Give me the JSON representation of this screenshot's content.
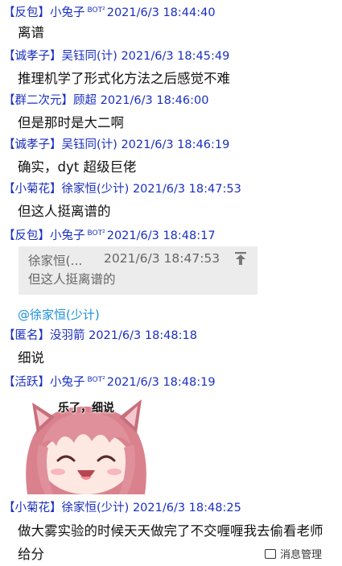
{
  "messages": [
    {
      "tag": "【反包】",
      "sender": "小兔子",
      "bot": "BOT²",
      "time": "2021/6/3 18:44:40",
      "text": "离谱"
    },
    {
      "tag": "【诚孝子】",
      "sender": "吴钰同(计)",
      "time": "2021/6/3 18:45:49",
      "text": "推理机学了形式化方法之后感觉不难"
    },
    {
      "tag": "【群二次元】",
      "sender": "顾超",
      "time": "2021/6/3 18:46:00",
      "text": "但是那时是大二啊"
    },
    {
      "tag": "【诚孝子】",
      "sender": "吴钰同(计)",
      "time": "2021/6/3 18:46:19",
      "text": "确实，dyt 超级巨佬"
    },
    {
      "tag": "【小菊花】",
      "sender": "徐家恒(少计)",
      "time": "2021/6/3 18:47:53",
      "text": "但这人挺离谱的"
    },
    {
      "tag": "【反包】",
      "sender": "小兔子",
      "bot": "BOT²",
      "time": "2021/6/3 18:48:17",
      "quote": {
        "name": "徐家恒(...",
        "time": "2021/6/3 18:47:53",
        "text": "但这人挺离谱的"
      },
      "mention": "@徐家恒(少计)"
    },
    {
      "tag": "【匿名】",
      "sender": "没羽箭",
      "time": "2021/6/3 18:48:18",
      "text": "细说"
    },
    {
      "tag": "【活跃】",
      "sender": "小兔子",
      "bot": "BOT²",
      "time": "2021/6/3 18:48:19",
      "sticker_caption": "乐了，细说"
    },
    {
      "tag": "【小菊花】",
      "sender": "徐家恒(少计)",
      "time": "2021/6/3 18:48:25",
      "text": "做大雾实验的时候天天做完了不交喱喱我去偷看老师给分"
    }
  ],
  "footer": {
    "label": "消息管理"
  },
  "colors": {
    "header": "#1a2fc0",
    "mention": "#1a8fd6",
    "quote_bg": "#ececec"
  }
}
